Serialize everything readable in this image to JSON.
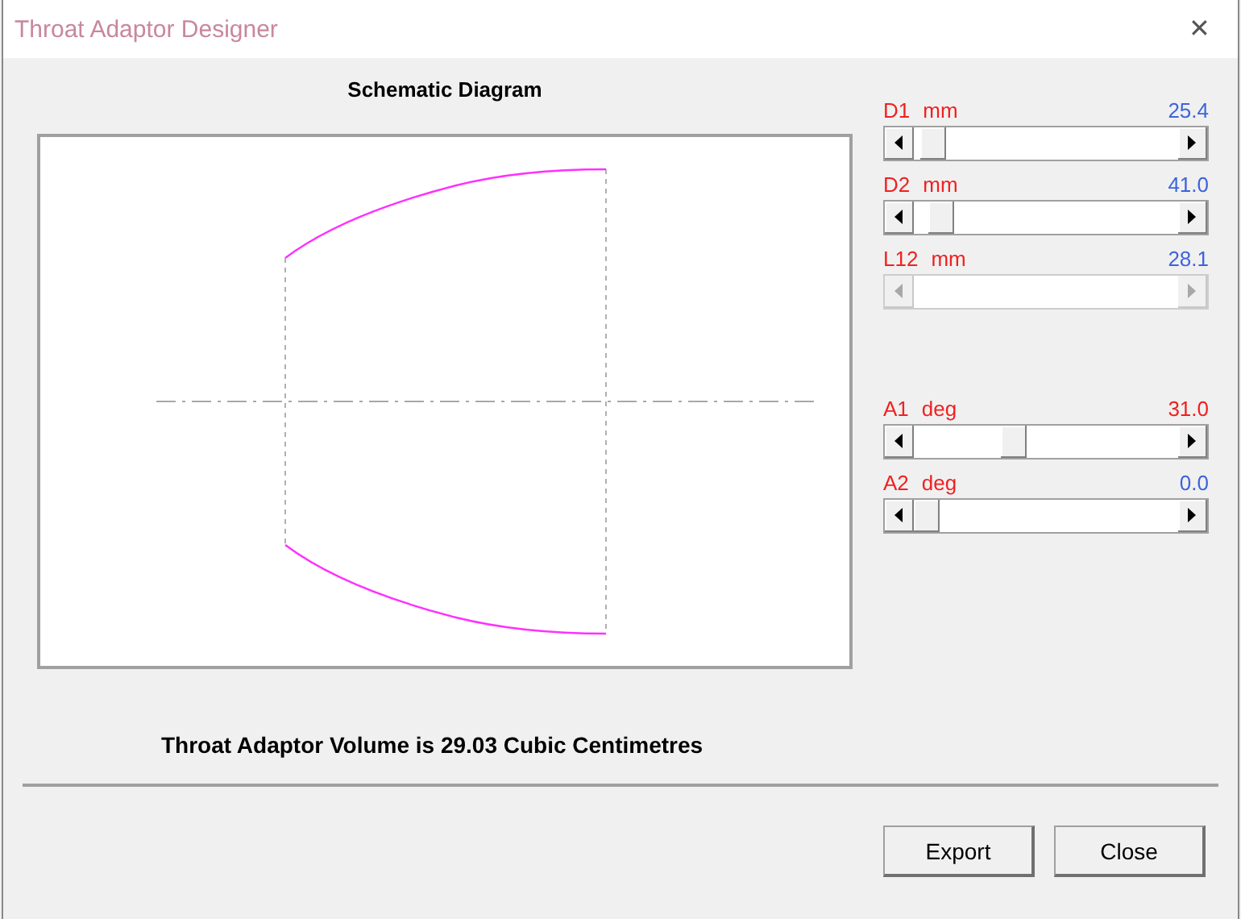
{
  "window": {
    "title": "Throat Adaptor Designer",
    "close_glyph": "✕"
  },
  "diagram": {
    "title": "Schematic Diagram"
  },
  "dimension_sliders": [
    {
      "name": "D1",
      "unit": "mm",
      "reading": "25.4",
      "color": "#3c64dc",
      "disabled": false
    },
    {
      "name": "D2",
      "unit": "mm",
      "reading": "41.0",
      "color": "#3c64dc",
      "disabled": false
    },
    {
      "name": "L12",
      "unit": "mm",
      "reading": "28.1",
      "color": "#3c64dc",
      "disabled": true
    }
  ],
  "angle_sliders": [
    {
      "name": "A1",
      "unit": "deg",
      "reading": "31.0",
      "color": "#f02020",
      "disabled": false
    },
    {
      "name": "A2",
      "unit": "deg",
      "reading": "0.0",
      "color": "#3c64dc",
      "disabled": false
    }
  ],
  "volume_text": "Throat Adaptor Volume is 29.03 Cubic Centimetres",
  "buttons": [
    {
      "label": "Export"
    },
    {
      "label": "Close"
    }
  ]
}
